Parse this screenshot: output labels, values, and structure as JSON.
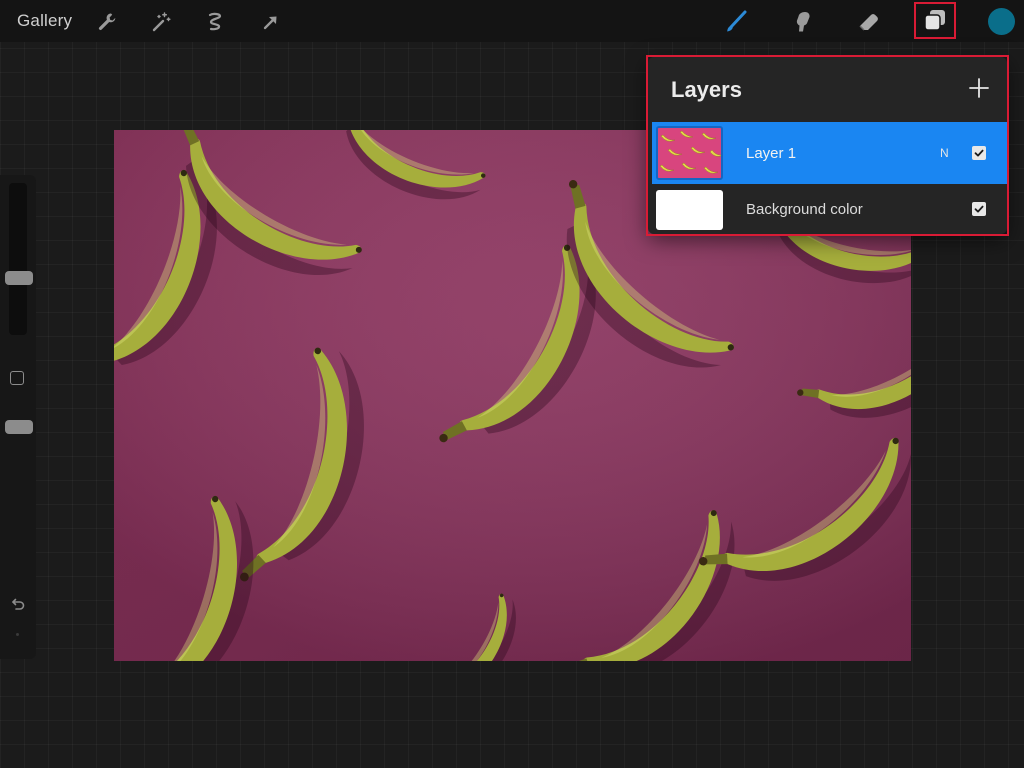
{
  "toolbar": {
    "gallery_label": "Gallery",
    "left_tools": [
      {
        "icon": "wrench-icon",
        "name": "actions"
      },
      {
        "icon": "magic-wand-icon",
        "name": "adjustments"
      },
      {
        "icon": "selection-icon",
        "name": "selection"
      },
      {
        "icon": "arrow-cursor-icon",
        "name": "transform"
      }
    ],
    "right_tools": [
      {
        "icon": "brush-icon",
        "name": "paint",
        "active": true
      },
      {
        "icon": "smudge-icon",
        "name": "smudge"
      },
      {
        "icon": "eraser-icon",
        "name": "eraser"
      },
      {
        "icon": "layers-icon",
        "name": "layers",
        "highlighted": true
      }
    ],
    "current_color": "#0a6e8a"
  },
  "sidebar": {
    "brush_size_level": 0.35,
    "opacity_level": 0.3,
    "buttons": [
      "modify-icon",
      "undo-icon",
      "redo-icon"
    ]
  },
  "canvas": {
    "subject": "Bananas on a magenta background",
    "background_color": "#8f3561",
    "banana_color": "#a6ae3c"
  },
  "layers_panel": {
    "title": "Layers",
    "add_icon": "plus-icon",
    "layers": [
      {
        "name": "Layer 1",
        "blend_mode": "N",
        "visible": true,
        "active": true
      },
      {
        "name": "Background color",
        "visible": true,
        "active": false
      }
    ]
  },
  "colors": {
    "accent_blue": "#1a86f2",
    "highlight_red": "#d91b35",
    "panel_bg": "#252525",
    "toolbar_bg": "#141414"
  }
}
